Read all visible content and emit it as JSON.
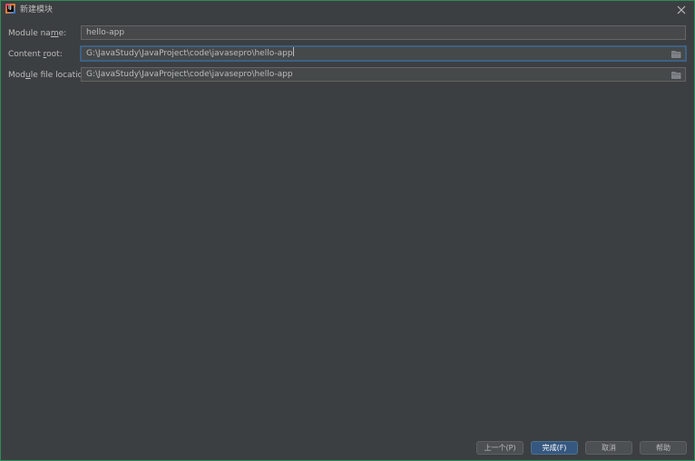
{
  "window": {
    "title": "新建模块",
    "app_icon_text": "IJ"
  },
  "form": {
    "module_name": {
      "label_pre": "Module na",
      "label_mnemonic": "m",
      "label_post": "e:",
      "value": "hello-app"
    },
    "content_root": {
      "label_pre": "Content ",
      "label_mnemonic": "r",
      "label_post": "oot:",
      "value": "G:\\JavaStudy\\JavaProject\\code\\javasepro\\hello-app"
    },
    "module_file_location": {
      "label_pre": "Mod",
      "label_mnemonic": "u",
      "label_post": "le file location:",
      "value": "G:\\JavaStudy\\JavaProject\\code\\javasepro\\hello-app"
    }
  },
  "buttons": {
    "previous": "上一个(P)",
    "finish": "完成(F)",
    "cancel": "取消",
    "help": "帮助"
  },
  "colors": {
    "background": "#3c3f41",
    "field_background": "#45494a",
    "focus_border": "#3d6185",
    "primary_button": "#365880",
    "window_border": "#2e8b57"
  }
}
